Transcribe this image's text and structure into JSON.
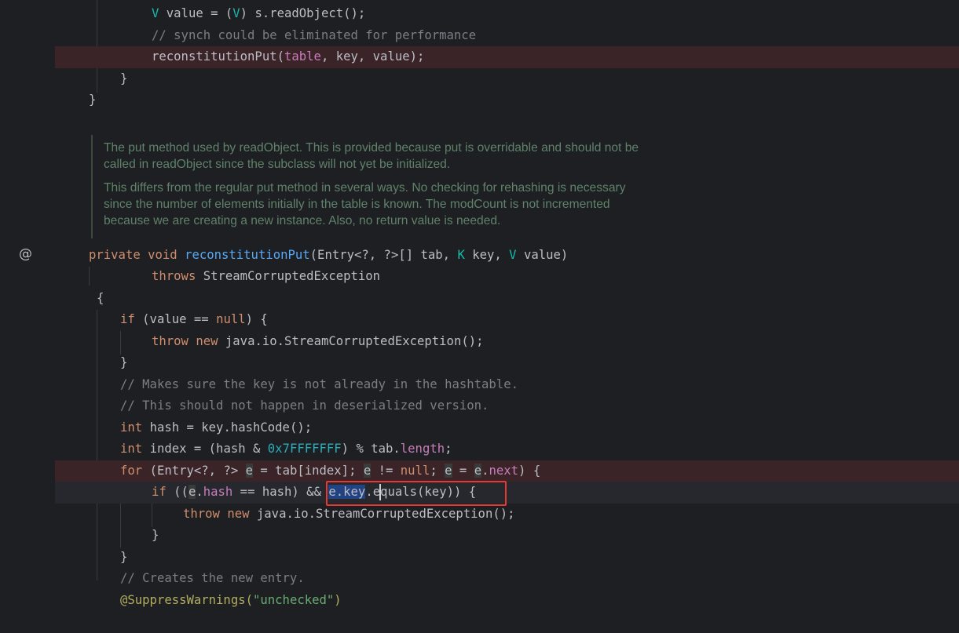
{
  "editor": {
    "gutter_icon": "@",
    "lines": {
      "l1": {
        "t1": "V",
        " t2": "",
        "t3": " value = (",
        "t4": "V",
        "t5": ") s.readObject();"
      },
      "l2": {
        "t1": "// synch could be eliminated for performance"
      },
      "l3": {
        "t1": "reconstitutionPut(",
        "t2": "table",
        "t3": ", key, value);"
      },
      "l4": {
        "t1": "}"
      },
      "l5": {
        "t1": "}"
      },
      "sig": {
        "t1": "private ",
        "t2": "void ",
        "t3": "reconstitutionPut",
        "t4": "(Entry<?, ?>[] tab, ",
        "t5": "K",
        "t6": " key, ",
        "t7": "V",
        "t8": " value)"
      },
      "throws": {
        "t1": "throws ",
        "t2": "StreamCorruptedException"
      },
      "open": {
        "t1": "{"
      },
      "if1": {
        "t1": "if ",
        "t2": "(value == ",
        "t3": "null",
        "t4": ") {"
      },
      "throw1": {
        "t1": "throw ",
        "t2": "new ",
        "t3": "java.io.StreamCorruptedException();"
      },
      "close1": {
        "t1": "}"
      },
      "c1": {
        "t1": "// Makes sure the key is not already in the hashtable."
      },
      "c2": {
        "t1": "// This should not happen in deserialized version."
      },
      "hash": {
        "t1": "int ",
        "t2": "hash = key.hashCode();"
      },
      "index": {
        "t1": "int ",
        "t2": "index = (hash & ",
        "t3": "0x7FFFFFFF",
        "t4": ") % tab.",
        "t5": "length",
        "t6": ";"
      },
      "for": {
        "t1": "for ",
        "t2": "(Entry<?, ?> ",
        "t3": "e",
        "t4": " = tab[index]; ",
        "t5": "e",
        "t6": " != ",
        "t7": "null",
        "t8": "; ",
        "t9": "e",
        "t10": " = ",
        "t11": "e",
        "t12": ".",
        "t13": "next",
        "t14": ") {"
      },
      "if2": {
        "t1": "if ",
        "t2": "((",
        "t3": "e",
        "t4": ".",
        "t5": "hash",
        "t6": " == hash) && ",
        "t7": "e.key",
        "t8": ".equals(key)) {"
      },
      "throw2": {
        "t1": "throw ",
        "t2": "new ",
        "t3": "java.io.StreamCorruptedException();"
      },
      "close2": {
        "t1": "}"
      },
      "close3": {
        "t1": "}"
      },
      "c3": {
        "t1": "// Creates the new entry."
      },
      "ann": {
        "t1": "@SuppressWarnings(",
        "t2": "\"unchecked\"",
        "t3": ")"
      }
    },
    "doc": {
      "p1a": "The put method used by readObject. This is provided because put is overridable and should not be",
      "p1b": "called in readObject since the subclass will not yet be initialized.",
      "p2a": "This differs from the regular put method in several ways. No checking for rehashing is necessary",
      "p2b": "since the number of elements initially in the table is known. The modCount is not incremented",
      "p2c": "because we are creating a new instance. Also, no return value is needed."
    }
  }
}
